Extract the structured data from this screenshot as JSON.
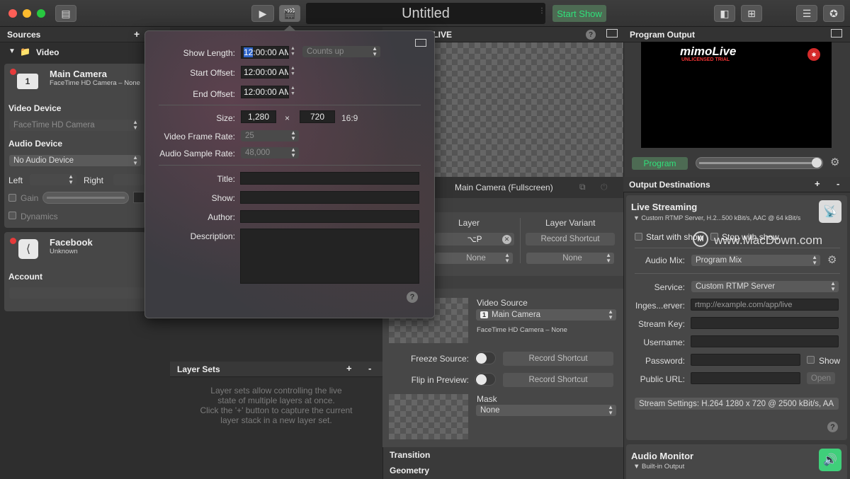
{
  "titlebar": {
    "doc_title": "Untitled",
    "start_show": "Start Show"
  },
  "sources": {
    "title": "Sources",
    "add": "+",
    "video_group": "Video",
    "main_camera": {
      "name": "Main Camera",
      "subtitle": "FaceTime HD Camera – None",
      "badge": "1",
      "video_device_label": "Video Device",
      "video_device_value": "FaceTime HD Camera",
      "audio_device_label": "Audio Device",
      "audio_device_value": "No Audio Device",
      "left_label": "Left",
      "right_label": "Right",
      "gain_label": "Gain",
      "dynamics_label": "Dynamics"
    },
    "facebook": {
      "name": "Facebook",
      "subtitle": "Unknown",
      "account_label": "Account"
    }
  },
  "popover": {
    "show_length_label": "Show Length:",
    "show_length_value_sel": "12",
    "show_length_value_rest": ":00:00 AM",
    "counts_up": "Counts up",
    "start_offset_label": "Start Offset:",
    "start_offset_value": "12:00:00 AM",
    "end_offset_label": "End Offset:",
    "end_offset_value": "12:00:00 AM",
    "size_label": "Size:",
    "width": "1,280",
    "times": "×",
    "height": "720",
    "aspect": "16:9",
    "frame_rate_label": "Video Frame Rate:",
    "frame_rate_value": "25",
    "sample_rate_label": "Audio Sample Rate:",
    "sample_rate_value": "48,000",
    "title_label": "Title:",
    "show_label": "Show:",
    "author_label": "Author:",
    "description_label": "Description:",
    "help": "?"
  },
  "layers": {
    "live_header": "5) - LIVE",
    "layer_name": "Main Camera (Fullscreen)",
    "layer_col": "Layer",
    "layer_variant_col": "Layer Variant",
    "shortcut_value": "⌥P",
    "record_shortcut": "Record Shortcut",
    "none1": "None",
    "none2": "None",
    "video_source_label": "Video Source",
    "video_source_value": "Main Camera",
    "video_source_badge": "1",
    "video_source_sub": "FaceTime HD Camera – None",
    "freeze_source": "Freeze Source:",
    "flip_preview": "Flip in Preview:",
    "record_shortcut_2": "Record Shortcut",
    "record_shortcut_3": "Record Shortcut",
    "mask_label": "Mask",
    "mask_value": "None",
    "transition": "Transition",
    "geometry": "Geometry"
  },
  "layer_sets": {
    "title": "Layer Sets",
    "add": "+",
    "remove": "-",
    "line1": "Layer sets allow controlling the live",
    "line2": "state of multiple layers at once.",
    "line3": "Click the '+' button to capture the current",
    "line4": "layer stack in a new layer set."
  },
  "output": {
    "program_output": "Program Output",
    "logo": "mimoLive",
    "trial": "UNLICENSED TRIAL",
    "program_btn": "Program",
    "destinations": "Output Destinations",
    "add": "+",
    "remove": "-",
    "live_streaming": "Live Streaming",
    "live_sub": "Custom RTMP Server, H.2...500 kBit/s, AAC @ 64 kBit/s",
    "start_with_show": "Start with show",
    "stop_with_show": "Stop with show",
    "watermark": "www.MacDown.com",
    "audio_mix_label": "Audio Mix:",
    "audio_mix_value": "Program Mix",
    "service_label": "Service:",
    "service_value": "Custom RTMP Server",
    "ingest_label": "Inges...erver:",
    "ingest_placeholder": "rtmp://example.com/app/live",
    "stream_key_label": "Stream Key:",
    "username_label": "Username:",
    "password_label": "Password:",
    "show_label": "Show",
    "public_url_label": "Public URL:",
    "open_btn": "Open",
    "stream_settings": "Stream Settings: H.264 1280 x 720 @ 2500 kBit/s, AA",
    "audio_monitor": "Audio Monitor",
    "audio_monitor_sub": "Built-in Output"
  }
}
